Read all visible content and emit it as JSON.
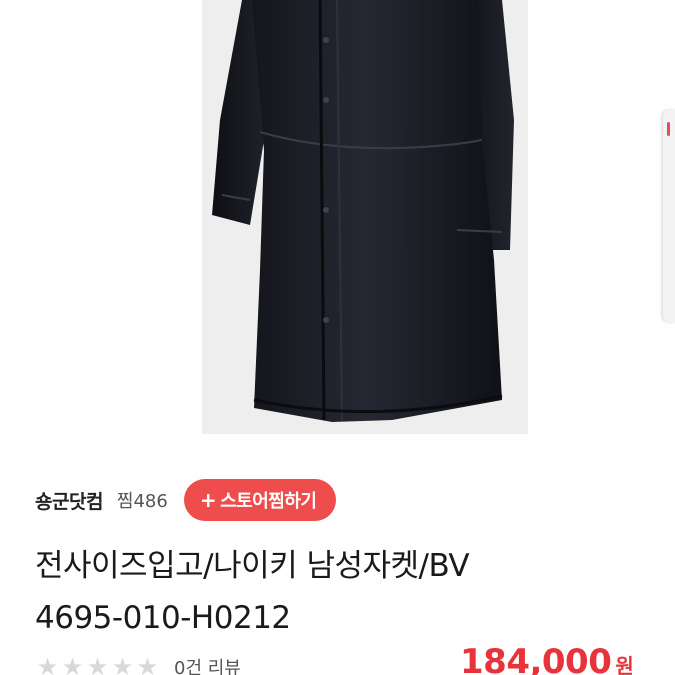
{
  "product": {
    "image_alt": "black long coat",
    "title": "전사이즈입고/나이키 남성자켓/BV4695-010-H0212"
  },
  "store": {
    "name": "숑군닷컴",
    "likes": "찜486",
    "follow_label": "스토어찜하기",
    "follow_icon": "+"
  },
  "rating": {
    "stars": [
      "★",
      "★",
      "★",
      "★",
      "★"
    ],
    "star_color": "#d8d8d8",
    "review_count": "0건 리뷰"
  },
  "price": {
    "value": "184,000",
    "unit": "원",
    "color": "#e8333a"
  },
  "colors": {
    "accent": "#ef4d4d"
  }
}
